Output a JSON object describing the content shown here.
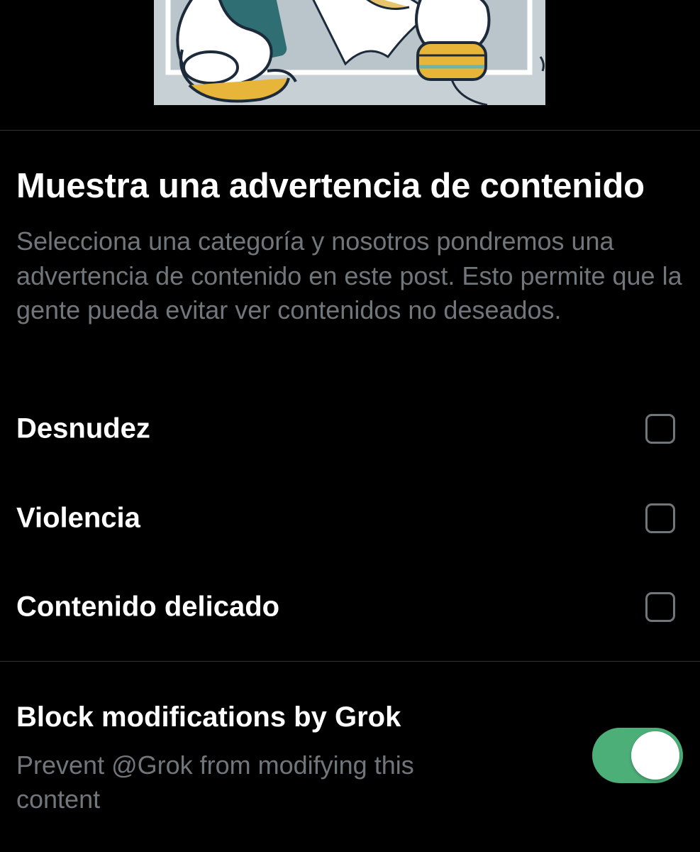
{
  "content_warning": {
    "title": "Muestra una advertencia de contenido",
    "description": "Selecciona una categoría y nosotros pondremos una advertencia de contenido en este post. Esto permite que la gente pueda evitar ver contenidos no deseados.",
    "options": [
      {
        "label": "Desnudez",
        "checked": false
      },
      {
        "label": "Violencia",
        "checked": false
      },
      {
        "label": "Contenido delicado",
        "checked": false
      }
    ]
  },
  "grok_block": {
    "title": "Block modifications by Grok",
    "description": "Prevent @Grok from modifying this content",
    "enabled": true
  },
  "colors": {
    "background": "#000000",
    "text_primary": "#ffffff",
    "text_secondary": "#71767b",
    "divider": "#2f3336",
    "toggle_on": "#4caf78"
  }
}
